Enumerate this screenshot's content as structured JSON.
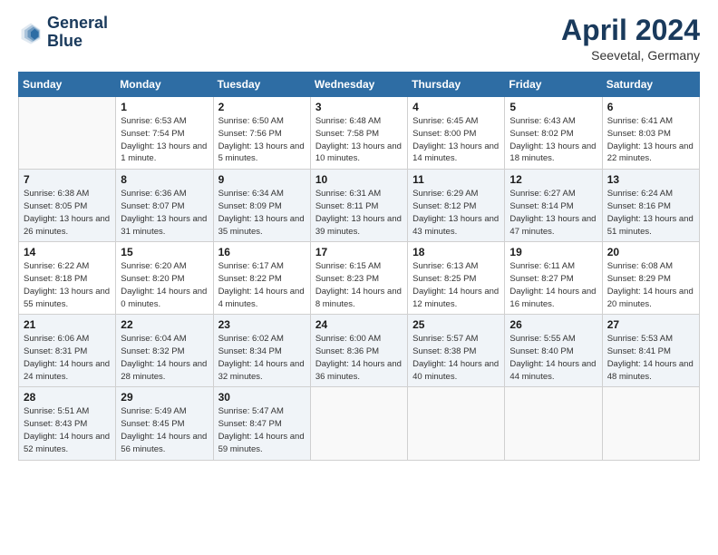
{
  "logo": {
    "line1": "General",
    "line2": "Blue"
  },
  "title": "April 2024",
  "subtitle": "Seevetal, Germany",
  "days_of_week": [
    "Sunday",
    "Monday",
    "Tuesday",
    "Wednesday",
    "Thursday",
    "Friday",
    "Saturday"
  ],
  "weeks": [
    [
      {
        "num": "",
        "sunrise": "",
        "sunset": "",
        "daylight": ""
      },
      {
        "num": "1",
        "sunrise": "Sunrise: 6:53 AM",
        "sunset": "Sunset: 7:54 PM",
        "daylight": "Daylight: 13 hours and 1 minute."
      },
      {
        "num": "2",
        "sunrise": "Sunrise: 6:50 AM",
        "sunset": "Sunset: 7:56 PM",
        "daylight": "Daylight: 13 hours and 5 minutes."
      },
      {
        "num": "3",
        "sunrise": "Sunrise: 6:48 AM",
        "sunset": "Sunset: 7:58 PM",
        "daylight": "Daylight: 13 hours and 10 minutes."
      },
      {
        "num": "4",
        "sunrise": "Sunrise: 6:45 AM",
        "sunset": "Sunset: 8:00 PM",
        "daylight": "Daylight: 13 hours and 14 minutes."
      },
      {
        "num": "5",
        "sunrise": "Sunrise: 6:43 AM",
        "sunset": "Sunset: 8:02 PM",
        "daylight": "Daylight: 13 hours and 18 minutes."
      },
      {
        "num": "6",
        "sunrise": "Sunrise: 6:41 AM",
        "sunset": "Sunset: 8:03 PM",
        "daylight": "Daylight: 13 hours and 22 minutes."
      }
    ],
    [
      {
        "num": "7",
        "sunrise": "Sunrise: 6:38 AM",
        "sunset": "Sunset: 8:05 PM",
        "daylight": "Daylight: 13 hours and 26 minutes."
      },
      {
        "num": "8",
        "sunrise": "Sunrise: 6:36 AM",
        "sunset": "Sunset: 8:07 PM",
        "daylight": "Daylight: 13 hours and 31 minutes."
      },
      {
        "num": "9",
        "sunrise": "Sunrise: 6:34 AM",
        "sunset": "Sunset: 8:09 PM",
        "daylight": "Daylight: 13 hours and 35 minutes."
      },
      {
        "num": "10",
        "sunrise": "Sunrise: 6:31 AM",
        "sunset": "Sunset: 8:11 PM",
        "daylight": "Daylight: 13 hours and 39 minutes."
      },
      {
        "num": "11",
        "sunrise": "Sunrise: 6:29 AM",
        "sunset": "Sunset: 8:12 PM",
        "daylight": "Daylight: 13 hours and 43 minutes."
      },
      {
        "num": "12",
        "sunrise": "Sunrise: 6:27 AM",
        "sunset": "Sunset: 8:14 PM",
        "daylight": "Daylight: 13 hours and 47 minutes."
      },
      {
        "num": "13",
        "sunrise": "Sunrise: 6:24 AM",
        "sunset": "Sunset: 8:16 PM",
        "daylight": "Daylight: 13 hours and 51 minutes."
      }
    ],
    [
      {
        "num": "14",
        "sunrise": "Sunrise: 6:22 AM",
        "sunset": "Sunset: 8:18 PM",
        "daylight": "Daylight: 13 hours and 55 minutes."
      },
      {
        "num": "15",
        "sunrise": "Sunrise: 6:20 AM",
        "sunset": "Sunset: 8:20 PM",
        "daylight": "Daylight: 14 hours and 0 minutes."
      },
      {
        "num": "16",
        "sunrise": "Sunrise: 6:17 AM",
        "sunset": "Sunset: 8:22 PM",
        "daylight": "Daylight: 14 hours and 4 minutes."
      },
      {
        "num": "17",
        "sunrise": "Sunrise: 6:15 AM",
        "sunset": "Sunset: 8:23 PM",
        "daylight": "Daylight: 14 hours and 8 minutes."
      },
      {
        "num": "18",
        "sunrise": "Sunrise: 6:13 AM",
        "sunset": "Sunset: 8:25 PM",
        "daylight": "Daylight: 14 hours and 12 minutes."
      },
      {
        "num": "19",
        "sunrise": "Sunrise: 6:11 AM",
        "sunset": "Sunset: 8:27 PM",
        "daylight": "Daylight: 14 hours and 16 minutes."
      },
      {
        "num": "20",
        "sunrise": "Sunrise: 6:08 AM",
        "sunset": "Sunset: 8:29 PM",
        "daylight": "Daylight: 14 hours and 20 minutes."
      }
    ],
    [
      {
        "num": "21",
        "sunrise": "Sunrise: 6:06 AM",
        "sunset": "Sunset: 8:31 PM",
        "daylight": "Daylight: 14 hours and 24 minutes."
      },
      {
        "num": "22",
        "sunrise": "Sunrise: 6:04 AM",
        "sunset": "Sunset: 8:32 PM",
        "daylight": "Daylight: 14 hours and 28 minutes."
      },
      {
        "num": "23",
        "sunrise": "Sunrise: 6:02 AM",
        "sunset": "Sunset: 8:34 PM",
        "daylight": "Daylight: 14 hours and 32 minutes."
      },
      {
        "num": "24",
        "sunrise": "Sunrise: 6:00 AM",
        "sunset": "Sunset: 8:36 PM",
        "daylight": "Daylight: 14 hours and 36 minutes."
      },
      {
        "num": "25",
        "sunrise": "Sunrise: 5:57 AM",
        "sunset": "Sunset: 8:38 PM",
        "daylight": "Daylight: 14 hours and 40 minutes."
      },
      {
        "num": "26",
        "sunrise": "Sunrise: 5:55 AM",
        "sunset": "Sunset: 8:40 PM",
        "daylight": "Daylight: 14 hours and 44 minutes."
      },
      {
        "num": "27",
        "sunrise": "Sunrise: 5:53 AM",
        "sunset": "Sunset: 8:41 PM",
        "daylight": "Daylight: 14 hours and 48 minutes."
      }
    ],
    [
      {
        "num": "28",
        "sunrise": "Sunrise: 5:51 AM",
        "sunset": "Sunset: 8:43 PM",
        "daylight": "Daylight: 14 hours and 52 minutes."
      },
      {
        "num": "29",
        "sunrise": "Sunrise: 5:49 AM",
        "sunset": "Sunset: 8:45 PM",
        "daylight": "Daylight: 14 hours and 56 minutes."
      },
      {
        "num": "30",
        "sunrise": "Sunrise: 5:47 AM",
        "sunset": "Sunset: 8:47 PM",
        "daylight": "Daylight: 14 hours and 59 minutes."
      },
      {
        "num": "",
        "sunrise": "",
        "sunset": "",
        "daylight": ""
      },
      {
        "num": "",
        "sunrise": "",
        "sunset": "",
        "daylight": ""
      },
      {
        "num": "",
        "sunrise": "",
        "sunset": "",
        "daylight": ""
      },
      {
        "num": "",
        "sunrise": "",
        "sunset": "",
        "daylight": ""
      }
    ]
  ]
}
